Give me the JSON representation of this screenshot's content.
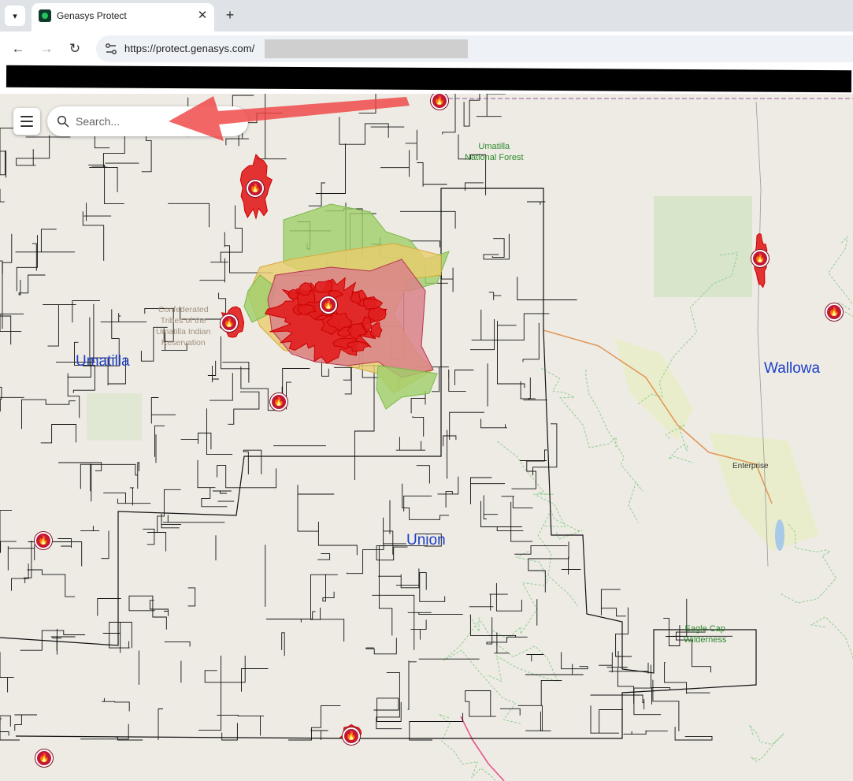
{
  "browser": {
    "tab_title": "Genasys Protect",
    "tab_close_glyph": "✕",
    "new_tab_glyph": "+",
    "tab_menu_glyph": "▾",
    "url": "https://protect.genasys.com/",
    "nav_back_glyph": "←",
    "nav_forward_glyph": "→",
    "nav_reload_glyph": "↻"
  },
  "map": {
    "search": {
      "placeholder": "Search..."
    },
    "labels": {
      "forest": "Umatilla National Forest",
      "forest_line1": "Umatilla",
      "forest_line2": "National Forest",
      "reservation_line1": "Confederated",
      "reservation_line2": "Tribes of the",
      "reservation_line3": "Umatilla Indian",
      "reservation_line4": "Reservation",
      "county_umatilla": "Umatilla",
      "county_union": "Union",
      "county_wallowa": "Wallowa",
      "town_enterprise": "Enterprise",
      "wilderness_line1": "Eagle Cap",
      "wilderness_line2": "Wilderness"
    },
    "fire_markers_count": 10,
    "colors": {
      "fire_red": "#e01e1e",
      "zone_red": "#d9828a",
      "zone_yellow": "#e9cc6e",
      "zone_green": "#9fd06a",
      "marker": "#c01836",
      "annotation_arrow": "#ef4444"
    }
  }
}
